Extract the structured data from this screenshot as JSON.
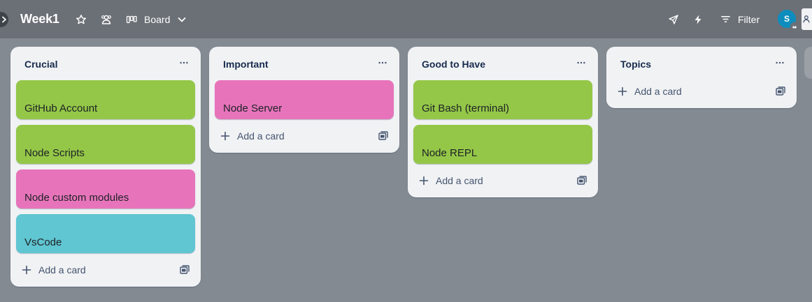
{
  "header": {
    "board_name": "Week1",
    "view_label": "Board",
    "filter_label": "Filter",
    "avatar_initial": "S"
  },
  "lists": [
    {
      "title": "Crucial",
      "add_label": "Add a card",
      "cards": [
        {
          "label": "GitHub Account",
          "color": "#94c748"
        },
        {
          "label": "Node Scripts",
          "color": "#94c748"
        },
        {
          "label": "Node custom modules",
          "color": "#e774bb"
        },
        {
          "label": "VsCode",
          "color": "#60c6d2"
        }
      ]
    },
    {
      "title": "Important",
      "add_label": "Add a card",
      "cards": [
        {
          "label": "Node Server",
          "color": "#e774bb"
        }
      ]
    },
    {
      "title": "Good to Have",
      "add_label": "Add a card",
      "cards": [
        {
          "label": "Git Bash (terminal)",
          "color": "#94c748"
        },
        {
          "label": "Node REPL",
          "color": "#94c748"
        }
      ]
    },
    {
      "title": "Topics",
      "add_label": "Add a card",
      "cards": []
    }
  ],
  "icons": {
    "sidebar_toggle": "chevron-right-icon",
    "star": "star-icon",
    "visibility": "workspace-visible-icon",
    "view": "board-view-icon",
    "view_switch": "chevron-down-icon",
    "power_ups": "rocket-icon",
    "automation": "lightning-icon",
    "filter": "filter-icon",
    "share": "add-member-icon"
  }
}
